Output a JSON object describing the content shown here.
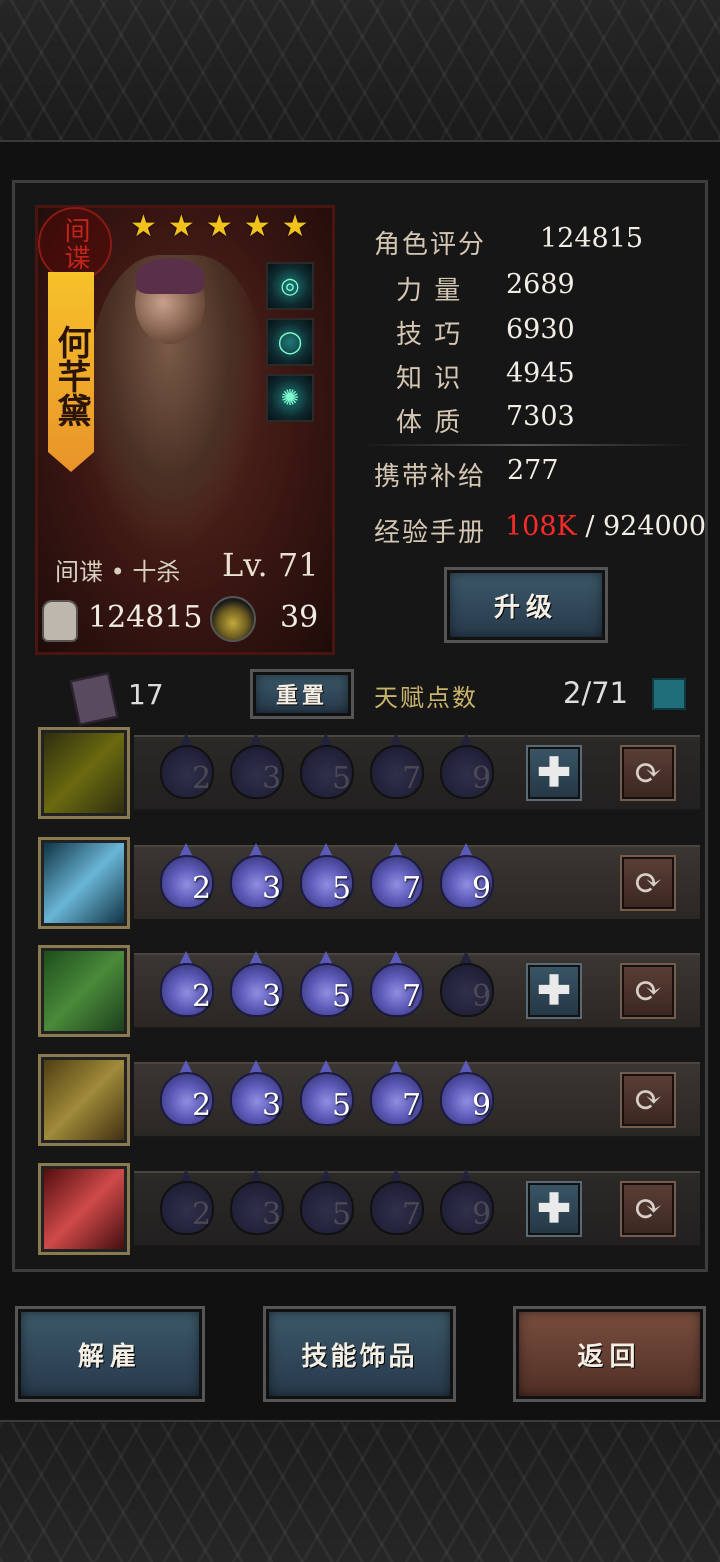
{
  "hero": {
    "class_seal": "间谍",
    "name": "何芊黛",
    "stars": 5,
    "class_line": "间谍 • 十杀",
    "level": "Lv. 71",
    "power": "124815",
    "supply_small": "39",
    "trinkets": [
      "trinket-necklace",
      "trinket-ring",
      "trinket-orb"
    ]
  },
  "stats": {
    "rating_label": "角色评分",
    "rating_value": "124815",
    "str_label": "力 量",
    "str_value": "2689",
    "skill_label": "技 巧",
    "skill_value": "6930",
    "know_label": "知 识",
    "know_value": "4945",
    "con_label": "体 质",
    "con_value": "7303",
    "supply_label": "携带补给",
    "supply_value": "277",
    "exp_label": "经验手册",
    "exp_current": "108K",
    "exp_total": "/ 924000"
  },
  "buttons": {
    "level_up": "升级",
    "reset": "重置",
    "dismiss": "解雇",
    "skill_trinkets": "技能饰品",
    "back": "返回"
  },
  "talent": {
    "book_count": "17",
    "label": "天赋点数",
    "count": "2/71"
  },
  "skills": [
    {
      "name": "crossed-blades",
      "levels": [
        {
          "n": "2",
          "on": false
        },
        {
          "n": "3",
          "on": false
        },
        {
          "n": "5",
          "on": false
        },
        {
          "n": "7",
          "on": false
        },
        {
          "n": "9",
          "on": false
        }
      ],
      "plus": true
    },
    {
      "name": "light-slash",
      "levels": [
        {
          "n": "2",
          "on": true
        },
        {
          "n": "3",
          "on": true
        },
        {
          "n": "5",
          "on": true
        },
        {
          "n": "7",
          "on": true
        },
        {
          "n": "9",
          "on": true
        }
      ],
      "plus": false
    },
    {
      "name": "strength-lift",
      "levels": [
        {
          "n": "2",
          "on": true
        },
        {
          "n": "3",
          "on": true
        },
        {
          "n": "5",
          "on": true
        },
        {
          "n": "7",
          "on": true
        },
        {
          "n": "9",
          "on": false
        }
      ],
      "plus": true
    },
    {
      "name": "muscle-flex",
      "levels": [
        {
          "n": "2",
          "on": true
        },
        {
          "n": "3",
          "on": true
        },
        {
          "n": "5",
          "on": true
        },
        {
          "n": "7",
          "on": true
        },
        {
          "n": "9",
          "on": true
        }
      ],
      "plus": false
    },
    {
      "name": "red-strike",
      "levels": [
        {
          "n": "2",
          "on": false
        },
        {
          "n": "3",
          "on": false
        },
        {
          "n": "5",
          "on": false
        },
        {
          "n": "7",
          "on": false
        },
        {
          "n": "9",
          "on": false
        }
      ],
      "plus": true
    }
  ],
  "colors": {
    "exp_current": "#ff2a2a",
    "star": "#f2c21c",
    "flame_on": "#5c5ab8"
  }
}
